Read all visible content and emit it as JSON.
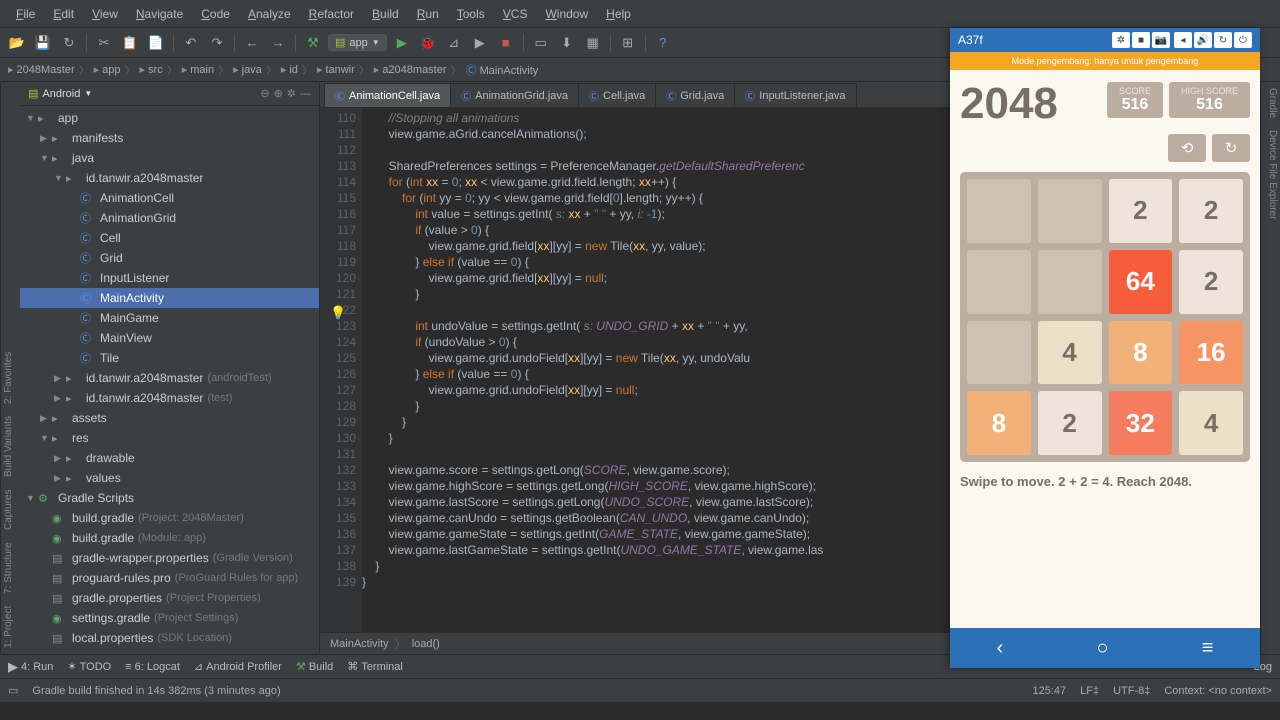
{
  "menu": [
    "File",
    "Edit",
    "View",
    "Navigate",
    "Code",
    "Analyze",
    "Refactor",
    "Build",
    "Run",
    "Tools",
    "VCS",
    "Window",
    "Help"
  ],
  "run_config": "app",
  "navcrumbs": [
    "2048Master",
    "app",
    "src",
    "main",
    "java",
    "id",
    "tanwir",
    "a2048master",
    "MainActivity"
  ],
  "panel_title": "Android",
  "tree": {
    "app": "app",
    "manifests": "manifests",
    "java": "java",
    "pkg": "id.tanwir.a2048master",
    "classes": [
      "AnimationCell",
      "AnimationGrid",
      "Cell",
      "Grid",
      "InputListener",
      "MainActivity",
      "MainGame",
      "MainView",
      "Tile"
    ],
    "pkg_atest": "id.tanwir.a2048master",
    "pkg_atest_hint": "(androidTest)",
    "pkg_test": "id.tanwir.a2048master",
    "pkg_test_hint": "(test)",
    "assets": "assets",
    "res": "res",
    "drawable": "drawable",
    "values": "values",
    "gradle_scripts": "Gradle Scripts",
    "g_items": [
      {
        "n": "build.gradle",
        "h": "(Project: 2048Master)",
        "t": "gradle"
      },
      {
        "n": "build.gradle",
        "h": "(Module: app)",
        "t": "gradle"
      },
      {
        "n": "gradle-wrapper.properties",
        "h": "(Gradle Version)",
        "t": "prop"
      },
      {
        "n": "proguard-rules.pro",
        "h": "(ProGuard Rules for app)",
        "t": "prop"
      },
      {
        "n": "gradle.properties",
        "h": "(Project Properties)",
        "t": "prop"
      },
      {
        "n": "settings.gradle",
        "h": "(Project Settings)",
        "t": "gradle"
      },
      {
        "n": "local.properties",
        "h": "(SDK Location)",
        "t": "prop"
      }
    ]
  },
  "tabs": [
    "AnimationCell.java",
    "AnimationGrid.java",
    "Cell.java",
    "Grid.java",
    "InputListener.java"
  ],
  "line_start": 110,
  "line_end": 139,
  "breadcrumb": [
    "MainActivity",
    "load()"
  ],
  "bottom": [
    "4: Run",
    "TODO",
    "6: Logcat",
    "Android Profiler",
    "Build",
    "Terminal"
  ],
  "status": {
    "msg": "Gradle build finished in 14s 382ms (3 minutes ago)",
    "pos": "125:47",
    "lf": "LF‡",
    "enc": "UTF-8‡",
    "context": "Context: <no context>",
    "log": "Log"
  },
  "emulator": {
    "device": "A37f",
    "banner": "Mode pengembang: hanya untuk pengembang",
    "title": "2048",
    "score_lbl": "SCORE",
    "score": "516",
    "highscore_lbl": "HIGH SCORE",
    "highscore": "516",
    "help": "Swipe to move. 2 + 2 = 4. Reach 2048.",
    "grid": [
      [
        "",
        "",
        "2",
        "2"
      ],
      [
        "",
        "",
        "64",
        "2"
      ],
      [
        "",
        "4",
        "8",
        "16"
      ],
      [
        "8",
        "2",
        "32",
        "4"
      ]
    ]
  }
}
